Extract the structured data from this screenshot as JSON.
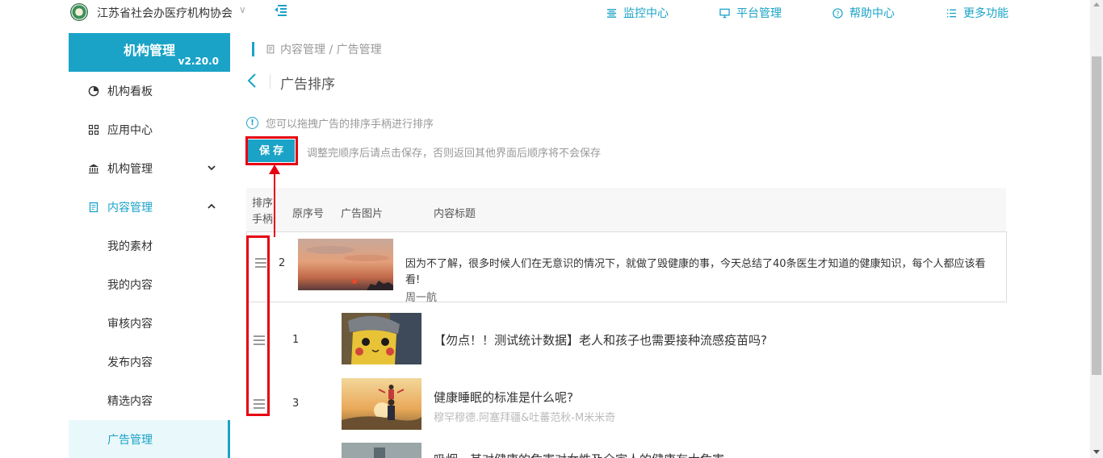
{
  "header": {
    "org_name": "江苏省社会办医疗机构协会",
    "nav": [
      {
        "label": "监控中心",
        "icon": "monitor-center-icon"
      },
      {
        "label": "平台管理",
        "icon": "desktop-icon"
      },
      {
        "label": "帮助中心",
        "icon": "help-circle-icon"
      },
      {
        "label": "更多功能",
        "icon": "list-icon"
      }
    ]
  },
  "sidebar": {
    "title": "机构管理",
    "version": "v2.20.0",
    "items": [
      {
        "label": "机构看板",
        "icon": "pie-chart-icon"
      },
      {
        "label": "应用中心",
        "icon": "grid-icon"
      },
      {
        "label": "机构管理",
        "icon": "bank-icon"
      },
      {
        "label": "内容管理",
        "icon": "document-icon"
      }
    ],
    "sub_items": [
      "我的素材",
      "我的内容",
      "审核内容",
      "发布内容",
      "精选内容",
      "广告管理"
    ]
  },
  "breadcrumb": "内容管理 / 广告管理",
  "page_title": "广告排序",
  "info_text": "您可以拖拽广告的排序手柄进行排序",
  "save_button": "保存",
  "save_note": "调整完顺序后请点击保存，否则返回其他界面后顺序将不会保存",
  "table": {
    "headers": {
      "handle": "排序手柄",
      "orig_no": "原序号",
      "image": "广告图片",
      "title": "内容标题"
    },
    "rows": [
      {
        "orig_no": "2",
        "title": "因为不了解，很多时候人们在无意识的情况下，就做了毁健康的事，今天总结了40条医生才知道的健康知识，每个人都应该看看!",
        "author": "周一航"
      },
      {
        "orig_no": "1",
        "title": "【勿点！！测试统计数据】老人和孩子也需要接种流感疫苗吗?",
        "author": ""
      },
      {
        "orig_no": "3",
        "title": "健康睡眠的标准是什么呢?",
        "author": "穆罕穆德.阿塞拜疆&吐蕃范秋-M米米奇"
      },
      {
        "orig_no": "",
        "title": "吸烟，其对健康的危害对女性及全家人的健康有大危害",
        "author": ""
      }
    ]
  }
}
